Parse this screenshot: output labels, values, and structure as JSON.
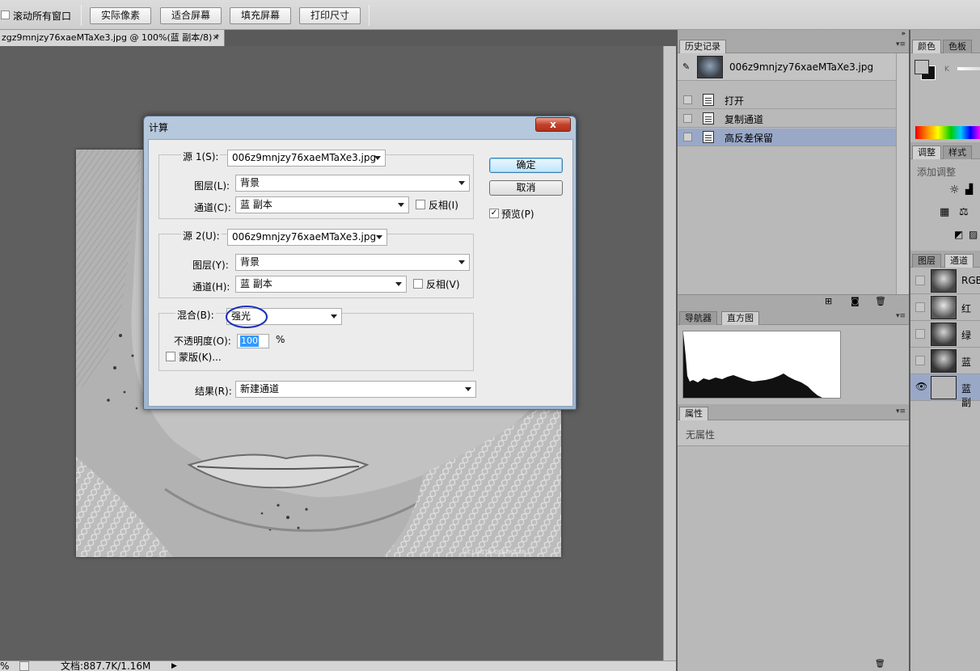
{
  "options_bar": {
    "scroll_all_label": "滚动所有窗口",
    "buttons": [
      "实际像素",
      "适合屏幕",
      "填充屏幕",
      "打印尺寸"
    ]
  },
  "document": {
    "tab_title": "zgz9mnjzy76xaeMTaXe3.jpg @ 100%(蓝 副本/8) *",
    "close_glyph": "×",
    "watermark": "(C) WITH-DEATHZ.SN"
  },
  "status_bar": {
    "zoom": "%",
    "doc_info": "文档:887.7K/1.16M",
    "arrow": "▶"
  },
  "history_panel": {
    "tab": "历史记录",
    "snapshot_name": "006z9mnjzy76xaeMTaXe3.jpg",
    "items": [
      {
        "label": "打开",
        "selected": false
      },
      {
        "label": "复制通道",
        "selected": false
      },
      {
        "label": "高反差保留",
        "selected": true
      }
    ]
  },
  "navigator_panel": {
    "tabs": [
      "导航器",
      "直方图"
    ],
    "active_tab": "直方图"
  },
  "properties_panel": {
    "tab": "属性",
    "empty_text": "无属性"
  },
  "color_panel": {
    "tabs": [
      "颜色",
      "色板"
    ],
    "k_label": "K"
  },
  "adjust_panel": {
    "tabs": [
      "调整",
      "样式"
    ],
    "add_label": "添加调整"
  },
  "channels_panel": {
    "tabs": [
      "图层",
      "通道"
    ],
    "active_tab": "通道",
    "channels": [
      {
        "label": "RGB",
        "visible": false,
        "selected": false
      },
      {
        "label": "红",
        "visible": false,
        "selected": false
      },
      {
        "label": "绿",
        "visible": false,
        "selected": false
      },
      {
        "label": "蓝",
        "visible": false,
        "selected": false
      },
      {
        "label": "蓝 副",
        "visible": true,
        "selected": true
      }
    ]
  },
  "dialog": {
    "title": "计算",
    "close_glyph": "x",
    "source1": {
      "label": "源 1(S):",
      "file": "006z9mnjzy76xaeMTaXe3.jpg",
      "layer_label": "图层(L):",
      "layer": "背景",
      "channel_label": "通道(C):",
      "channel": "蓝 副本",
      "invert_label": "反相(I)",
      "invert": false
    },
    "source2": {
      "label": "源 2(U):",
      "file": "006z9mnjzy76xaeMTaXe3.jpg",
      "layer_label": "图层(Y):",
      "layer": "背景",
      "channel_label": "通道(H):",
      "channel": "蓝 副本",
      "invert_label": "反相(V)",
      "invert": false
    },
    "blend": {
      "label": "混合(B):",
      "mode": "强光",
      "opacity_label": "不透明度(O):",
      "opacity": "100",
      "percent": "%",
      "mask_label": "蒙版(K)...",
      "mask": false
    },
    "result": {
      "label": "结果(R):",
      "value": "新建通道"
    },
    "ok_label": "确定",
    "cancel_label": "取消",
    "preview_label": "预览(P)",
    "preview": true,
    "preview_check": "✓"
  }
}
